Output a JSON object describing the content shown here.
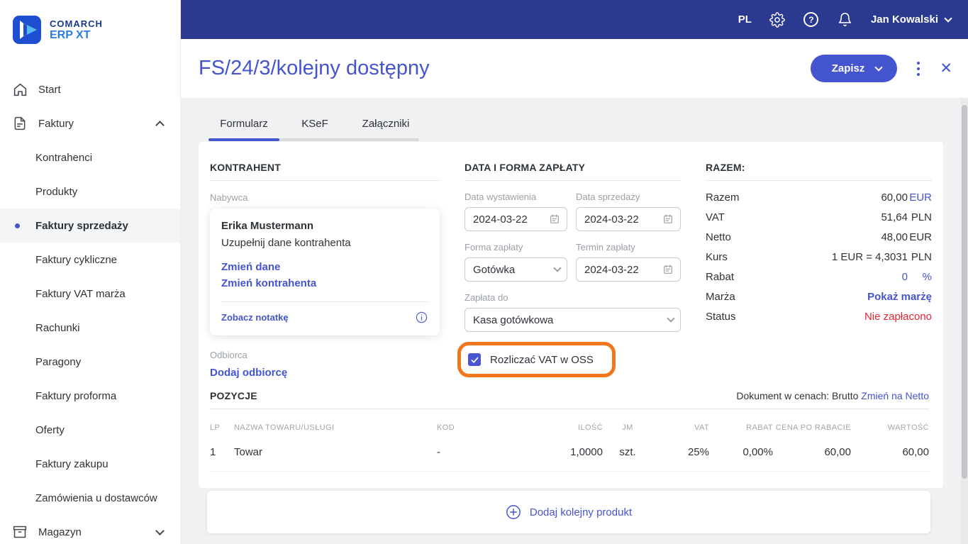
{
  "logo": {
    "line1": "COMARCH",
    "line2": "ERP XT"
  },
  "topbar": {
    "language": "PL",
    "user": "Jan Kowalski"
  },
  "header": {
    "title": "FS/24/3/kolejny dostępny",
    "save_label": "Zapisz",
    "close_label": "✕"
  },
  "tabs": [
    {
      "label": "Formularz",
      "active": true
    },
    {
      "label": "KSeF",
      "active": false
    },
    {
      "label": "Załączniki",
      "active": false
    }
  ],
  "sidebar": {
    "items": [
      {
        "label": "Start"
      },
      {
        "label": "Faktury"
      },
      {
        "label": "Kontrahenci"
      },
      {
        "label": "Produkty"
      },
      {
        "label": "Faktury sprzedaży",
        "active": true
      },
      {
        "label": "Faktury cykliczne"
      },
      {
        "label": "Faktury VAT marża"
      },
      {
        "label": "Rachunki"
      },
      {
        "label": "Paragony"
      },
      {
        "label": "Faktury proforma"
      },
      {
        "label": "Oferty"
      },
      {
        "label": "Faktury zakupu"
      },
      {
        "label": "Zamówienia u dostawców"
      },
      {
        "label": "Magazyn"
      }
    ]
  },
  "kontrahent": {
    "section_title": "KONTRAHENT",
    "buyer_label": "Nabywca",
    "buyer_name": "Erika Mustermann",
    "buyer_hint": "Uzupełnij dane kontrahenta",
    "change_data_link": "Zmień dane",
    "change_contractor_link": "Zmień kontrahenta",
    "see_note_link": "Zobacz notatkę",
    "receiver_label": "Odbiorca",
    "add_receiver_link": "Dodaj odbiorcę"
  },
  "payment": {
    "section_title": "DATA I FORMA ZAPŁATY",
    "issue_date_label": "Data wystawienia",
    "issue_date": "2024-03-22",
    "sale_date_label": "Data sprzedaży",
    "sale_date": "2024-03-22",
    "form_label": "Forma zapłaty",
    "form_value": "Gotówka",
    "term_label": "Termin zapłaty",
    "term_date": "2024-03-22",
    "pay_to_label": "Zapłata do",
    "pay_to_value": "Kasa gotówkowa",
    "oss_label": "Rozliczać VAT w OSS",
    "oss_checked": true
  },
  "totals": {
    "section_title": "RAZEM:",
    "rows": [
      {
        "label": "Razem",
        "value": "60,00",
        "unit": "EUR"
      },
      {
        "label": "VAT",
        "value": "51,64",
        "unit": "PLN"
      },
      {
        "label": "Netto",
        "value": "48,00",
        "unit": "EUR"
      },
      {
        "label": "Kurs",
        "value": "1 EUR = 4,3031",
        "unit": "PLN"
      },
      {
        "label": "Rabat",
        "value": "0",
        "unit": "%"
      },
      {
        "label": "Marża",
        "value": "Pokaż marżę",
        "unit": ""
      },
      {
        "label": "Status",
        "value": "Nie zapłacono",
        "unit": ""
      }
    ]
  },
  "items": {
    "section_title": "POZYCJE",
    "doc_prices_text": "Dokument w cenach: Brutto",
    "switch_link": "Zmień na Netto",
    "columns": [
      "LP",
      "NAZWA TOWARU/USŁUGI",
      "KOD",
      "ILOŚĆ",
      "JM",
      "VAT",
      "RABAT",
      "CENA PO RABACIE",
      "WARTOŚĆ"
    ],
    "rows": [
      [
        "1",
        "Towar",
        "-",
        "1,0000",
        "szt.",
        "25%",
        "0,00%",
        "60,00",
        "60,00"
      ]
    ],
    "add_product_label": "Dodaj kolejny produkt"
  },
  "colors": {
    "accent_blue": "#4554cf",
    "topbar_navy": "#2b3a8f",
    "highlight_orange": "#f2761c",
    "status_red": "#e22535"
  }
}
